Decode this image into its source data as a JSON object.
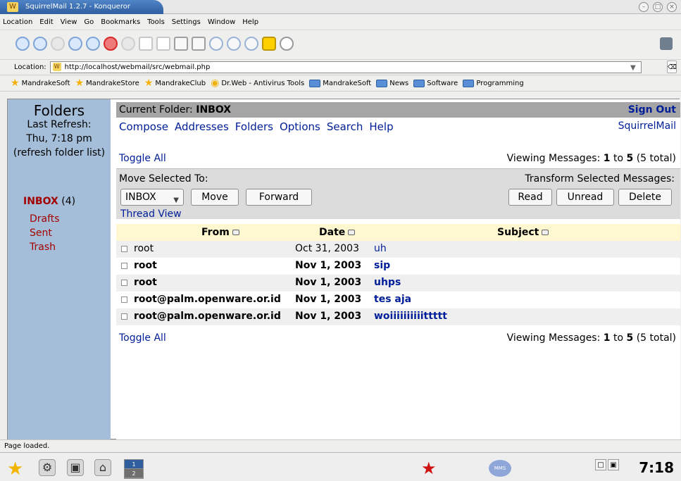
{
  "window": {
    "title": "SquirrelMail 1.2.7 - Konqueror"
  },
  "menubar": [
    "Location",
    "Edit",
    "View",
    "Go",
    "Bookmarks",
    "Tools",
    "Settings",
    "Window",
    "Help"
  ],
  "locationbar": {
    "label": "Location:",
    "url": "http://localhost/webmail/src/webmail.php"
  },
  "bookmarks": [
    "MandrakeSoft",
    "MandrakeStore",
    "MandrakeClub",
    "Dr.Web - Antivirus Tools",
    "MandrakeSoft",
    "News",
    "Software",
    "Programming"
  ],
  "folders": {
    "title": "Folders",
    "refresh_line1": "Last Refresh:",
    "refresh_line2": "Thu, 7:18 pm",
    "refresh_link": "(refresh folder list)",
    "inbox": "INBOX",
    "inbox_count": "(4)",
    "drafts": "Drafts",
    "sent": "Sent",
    "trash": "Trash"
  },
  "header": {
    "current_folder_prefix": "Current Folder:",
    "current_folder": "INBOX",
    "sign_out": "Sign Out"
  },
  "nav": {
    "compose": "Compose",
    "addresses": "Addresses",
    "folders": "Folders",
    "options": "Options",
    "search": "Search",
    "help": "Help",
    "brand": "SquirrelMail"
  },
  "messages": {
    "toggle_all": "Toggle All",
    "viewing_prefix": "Viewing Messages:",
    "viewing_from": "1",
    "viewing_to": "to",
    "viewing_last": "5",
    "viewing_total": "(5 total)",
    "move_label": "Move Selected To:",
    "transform_label": "Transform Selected Messages:",
    "move_select": "INBOX",
    "move_button": "Move",
    "forward_button": "Forward",
    "read_button": "Read",
    "unread_button": "Unread",
    "delete_button": "Delete",
    "thread_view": "Thread View",
    "col_from": "From",
    "col_date": "Date",
    "col_subject": "Subject",
    "rows": [
      {
        "from": "root",
        "date": "Oct 31, 2003",
        "subject": "uh",
        "bold": false
      },
      {
        "from": "root",
        "date": "Nov 1, 2003",
        "subject": "sip",
        "bold": true
      },
      {
        "from": "root",
        "date": "Nov 1, 2003",
        "subject": "uhps",
        "bold": true
      },
      {
        "from": "root@palm.openware.or.id",
        "date": "Nov 1, 2003",
        "subject": "tes aja",
        "bold": true
      },
      {
        "from": "root@palm.openware.or.id",
        "date": "Nov 1, 2003",
        "subject": "woiiiiiiiiiittttt",
        "bold": true
      }
    ]
  },
  "status": "Page loaded.",
  "taskbar": {
    "clock": "7:18",
    "pager_labels": [
      "1",
      "2"
    ]
  }
}
